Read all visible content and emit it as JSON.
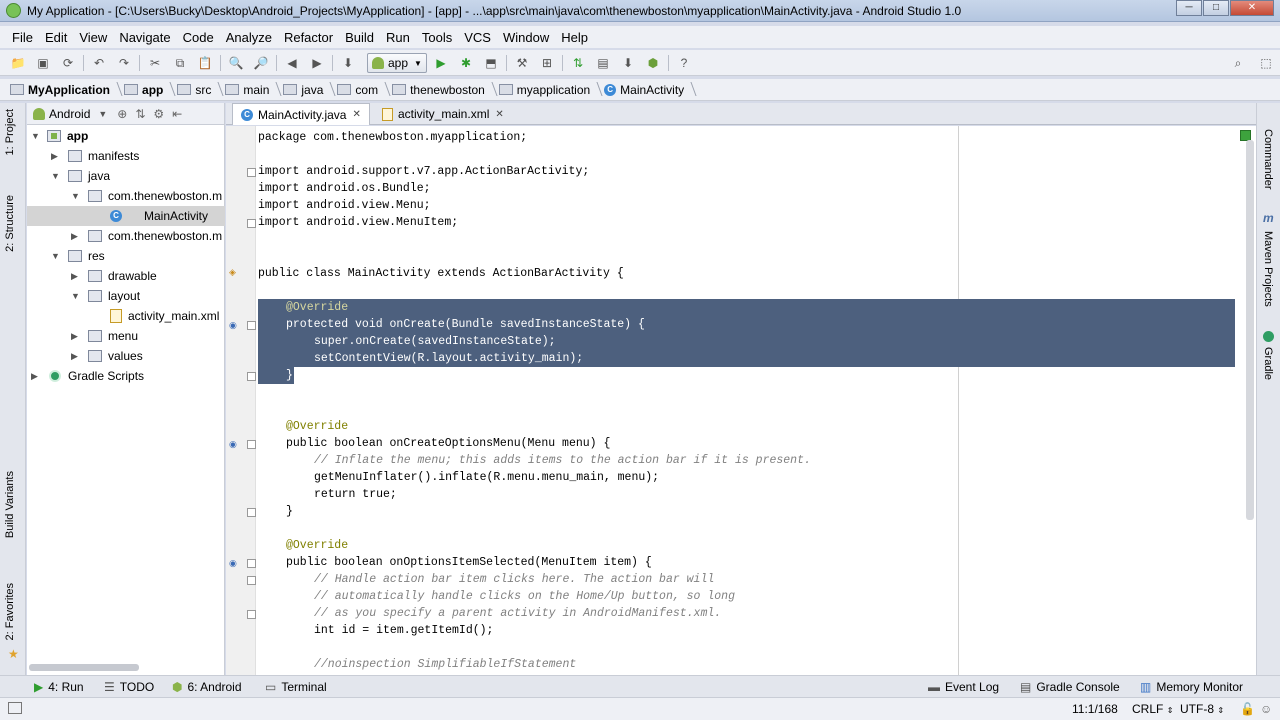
{
  "window": {
    "title": "My Application - [C:\\Users\\Bucky\\Desktop\\Android_Projects\\MyApplication] - [app] - ...\\app\\src\\main\\java\\com\\thenewboston\\myapplication\\MainActivity.java - Android Studio 1.0",
    "controls": {
      "minimize": "─",
      "maximize": "□",
      "close": "✕"
    }
  },
  "menubar": [
    "File",
    "Edit",
    "View",
    "Navigate",
    "Code",
    "Analyze",
    "Refactor",
    "Build",
    "Run",
    "Tools",
    "VCS",
    "Window",
    "Help"
  ],
  "toolbar": {
    "run_config": "app"
  },
  "breadcrumbs": [
    "MyApplication",
    "app",
    "src",
    "main",
    "java",
    "com",
    "thenewboston",
    "myapplication",
    "MainActivity"
  ],
  "project_panel": {
    "view_mode": "Android",
    "tree": [
      {
        "label": "app",
        "bold": true
      },
      {
        "label": "manifests"
      },
      {
        "label": "java"
      },
      {
        "label": "com.thenewboston.m"
      },
      {
        "label": "MainActivity"
      },
      {
        "label": "com.thenewboston.m"
      },
      {
        "label": "res"
      },
      {
        "label": "drawable"
      },
      {
        "label": "layout"
      },
      {
        "label": "activity_main.xml"
      },
      {
        "label": "menu"
      },
      {
        "label": "values"
      },
      {
        "label": "Gradle Scripts"
      }
    ]
  },
  "left_tool_tabs": [
    "1: Project",
    "2: Structure",
    "Build Variants",
    "2: Favorites"
  ],
  "right_tool_tabs": [
    "Commander",
    "Maven Projects",
    "Gradle"
  ],
  "editor_tabs": [
    {
      "label": "MainActivity.java",
      "active": true
    },
    {
      "label": "activity_main.xml",
      "active": false
    }
  ],
  "code_lines": [
    "package com.thenewboston.myapplication;",
    "import android.support.v7.app.ActionBarActivity;",
    "import android.os.Bundle;",
    "import android.view.Menu;",
    "import android.view.MenuItem;",
    "public class MainActivity extends ActionBarActivity {",
    "@Override",
    "protected void onCreate(Bundle savedInstanceState) {",
    "super.onCreate(savedInstanceState);",
    "setContentView(R.layout.activity_main);",
    "}",
    "@Override",
    "public boolean onCreateOptionsMenu(Menu menu) {",
    "// Inflate the menu; this adds items to the action bar if it is present.",
    "getMenuInflater().inflate(R.menu.menu_main, menu);",
    "return true;",
    "}",
    "@Override",
    "public boolean onOptionsItemSelected(MenuItem item) {",
    "// Handle action bar item clicks here. The action bar will",
    "// automatically handle clicks on the Home/Up button, so long",
    "// as you specify a parent activity in AndroidManifest.xml.",
    "int id = item.getItemId();",
    "//noinspection SimplifiableIfStatement"
  ],
  "bottom_tabs": {
    "run": "4: Run",
    "todo": "TODO",
    "android": "6: Android",
    "terminal": "Terminal",
    "event_log": "Event Log",
    "gradle_console": "Gradle Console",
    "memory_monitor": "Memory Monitor"
  },
  "status": {
    "position": "11:1/168",
    "line_sep": "CRLF",
    "encoding": "UTF-8"
  }
}
